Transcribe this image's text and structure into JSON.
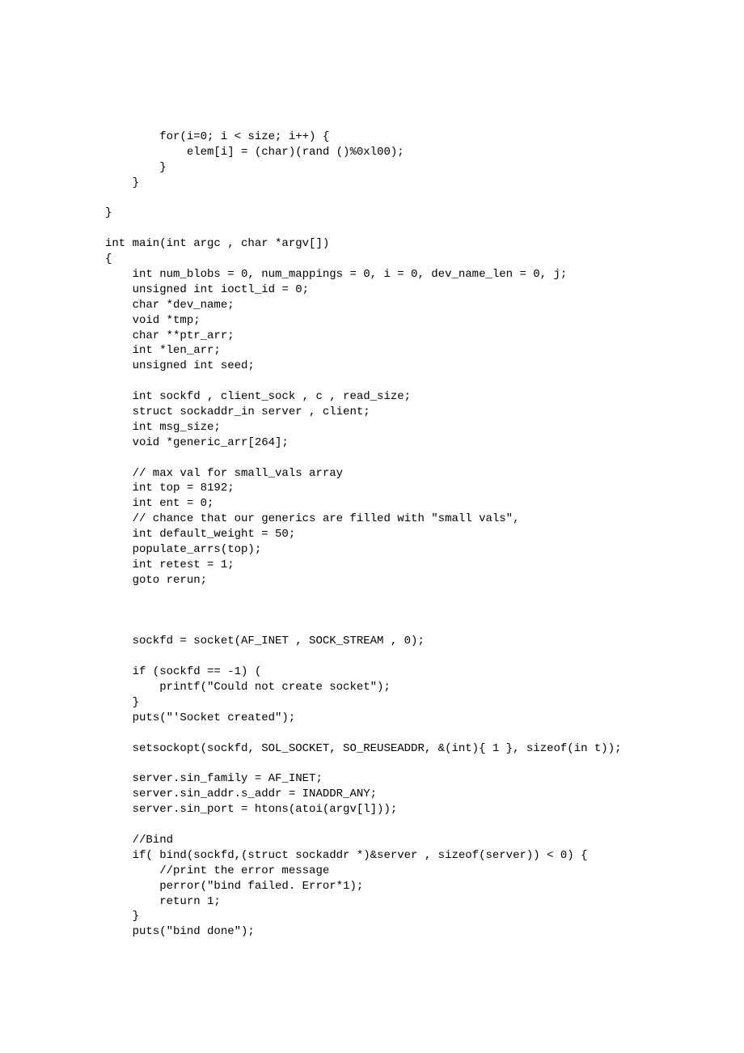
{
  "code": {
    "lines": [
      "        for(i=0; i < size; i++) {",
      "            elem[i] = (char)(rand ()%0xl00);",
      "        }",
      "    }",
      "",
      "}",
      "",
      "int main(int argc , char *argv[])",
      "{",
      "    int num_blobs = 0, num_mappings = 0, i = 0, dev_name_len = 0, j;",
      "    unsigned int ioctl_id = 0;",
      "    char *dev_name;",
      "    void *tmp;",
      "    char **ptr_arr;",
      "    int *len_arr;",
      "    unsigned int seed;",
      "",
      "    int sockfd , client_sock , c , read_size;",
      "    struct sockaddr_in server , client;",
      "    int msg_size;",
      "    void *generic_arr[264];",
      "",
      "    // max val for small_vals array",
      "    int top = 8192;",
      "    int ent = 0;",
      "    // chance that our generics are filled with \"small vals\",",
      "    int default_weight = 50;",
      "    populate_arrs(top);",
      "    int retest = 1;",
      "    goto rerun;",
      "",
      "",
      "",
      "    sockfd = socket(AF_INET , SOCK_STREAM , 0);",
      "",
      "    if (sockfd == -1) (",
      "        printf(\"Could not create socket\");",
      "    }",
      "    puts(\"'Socket created\");",
      "",
      "    setsockopt(sockfd, SOL_SOCKET, SO_REUSEADDR, &(int){ 1 }, sizeof(in t));",
      "",
      "    server.sin_family = AF_INET;",
      "    server.sin_addr.s_addr = INADDR_ANY;",
      "    server.sin_port = htons(atoi(argv[l]));",
      "",
      "    //Bind",
      "    if( bind(sockfd,(struct sockaddr *)&server , sizeof(server)) < 0) {",
      "        //print the error message",
      "        perror(\"bind failed. Error*1);",
      "        return 1;",
      "    }",
      "    puts(\"bind done\");"
    ]
  }
}
